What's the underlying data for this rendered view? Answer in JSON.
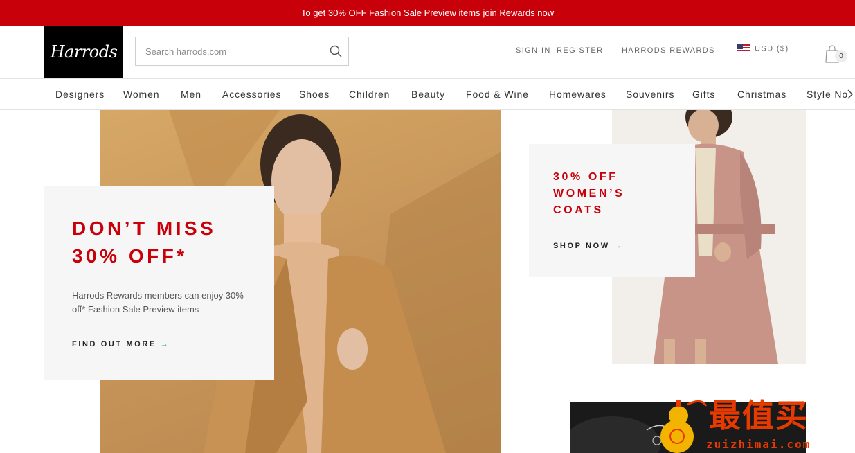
{
  "promo": {
    "text": "To get 30% OFF Fashion Sale Preview items",
    "link": "join Rewards now"
  },
  "header": {
    "logo": "Harrods",
    "search_placeholder": "Search harrods.com",
    "sign_in": "SIGN IN",
    "register": "REGISTER",
    "rewards": "HARRODS REWARDS",
    "currency": "USD ($)",
    "bag_count": "0"
  },
  "nav": {
    "items": [
      "Designers",
      "Women",
      "Men",
      "Accessories",
      "Shoes",
      "Children",
      "Beauty",
      "Food & Wine",
      "Homewares",
      "Souvenirs",
      "Gifts",
      "Christmas",
      "Style Notes"
    ]
  },
  "hero_left": {
    "headline_line1": "DON’T MISS",
    "headline_line2": "30% OFF*",
    "body": "Harrods Rewards members can enjoy 30% off* Fashion Sale Preview items",
    "cta": "FIND OUT MORE"
  },
  "hero_right": {
    "headline_line1": "30% OFF",
    "headline_line2": "WOMEN’S",
    "headline_line3": "COATS",
    "cta": "SHOP NOW"
  },
  "watermark": {
    "title": "最值买",
    "url": "zuizhimai.com"
  },
  "colors": {
    "brand_red": "#c8000a",
    "arrow_teal": "#3aa0b8",
    "card_bg": "#f6f6f6"
  }
}
